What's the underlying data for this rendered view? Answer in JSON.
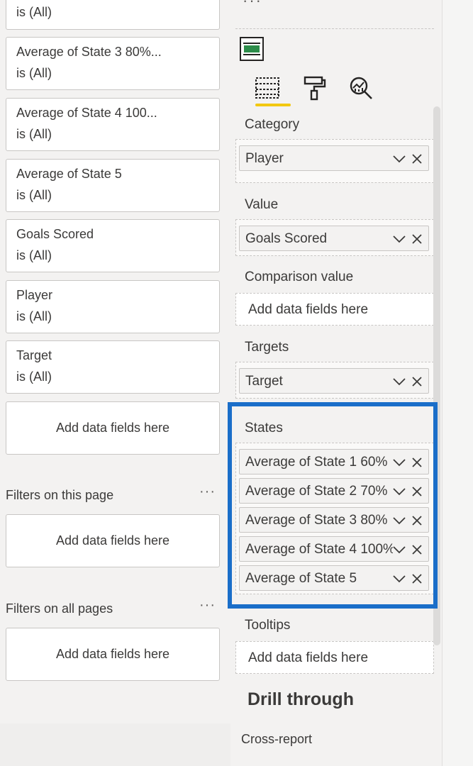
{
  "filters_pane": {
    "visual_filters": [
      {
        "field": "",
        "condition": "is (All)"
      },
      {
        "field": "Average of State 3 80%...",
        "condition": "is (All)"
      },
      {
        "field": "Average of State 4 100...",
        "condition": "is (All)"
      },
      {
        "field": "Average of State 5",
        "condition": "is (All)"
      },
      {
        "field": "Goals Scored",
        "condition": "is (All)"
      },
      {
        "field": "Player",
        "condition": "is (All)"
      },
      {
        "field": "Target",
        "condition": "is (All)"
      }
    ],
    "add_fields_visual": "Add data fields here",
    "page_section": {
      "title": "Filters on this page",
      "more": "···",
      "add_fields": "Add data fields here"
    },
    "all_pages_section": {
      "title": "Filters on all pages",
      "more": "···",
      "add_fields": "Add data fields here"
    }
  },
  "viz_pane": {
    "top_more": "···",
    "tabs": [
      {
        "name": "fields-tab",
        "icon": "fields-grid-icon",
        "active": true
      },
      {
        "name": "format-tab",
        "icon": "paint-roller-icon",
        "active": false
      },
      {
        "name": "analytics-tab",
        "icon": "analytics-magnifier-icon",
        "active": false
      }
    ],
    "wells": {
      "category": {
        "label": "Category",
        "field": "Player"
      },
      "value": {
        "label": "Value",
        "field": "Goals Scored"
      },
      "comparison": {
        "label": "Comparison value",
        "placeholder": "Add data fields here"
      },
      "targets": {
        "label": "Targets",
        "field": "Target"
      },
      "states": {
        "label": "States",
        "fields": [
          "Average of State 1 60%",
          "Average of State 2 70%",
          "Average of State 3 80%",
          "Average of State 4 100%",
          "Average of State 5"
        ]
      },
      "tooltips": {
        "label": "Tooltips",
        "placeholder": "Add data fields here"
      }
    },
    "drill_through": {
      "title": "Drill through",
      "cross_report": "Cross-report"
    }
  },
  "colors": {
    "highlight": "#1a6ec9",
    "active_tab_underline": "#f2c811",
    "visual_icon_bar": "#2c8c4a"
  }
}
